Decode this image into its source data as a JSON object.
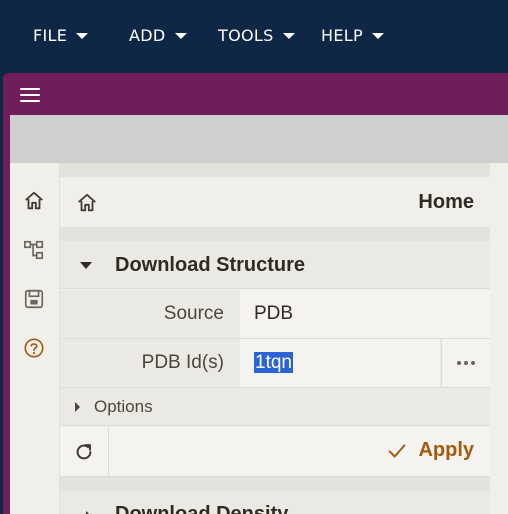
{
  "menu": [
    {
      "label": "FILE"
    },
    {
      "label": "ADD"
    },
    {
      "label": "TOOLS"
    },
    {
      "label": "HELP"
    }
  ],
  "colors": {
    "menubar": "#0f2746",
    "frame": "#701e5a",
    "selection": "#2b63d4",
    "apply": "#a65a10"
  },
  "rail": {
    "icons": [
      "home-icon",
      "tree-icon",
      "save-icon",
      "help-icon"
    ]
  },
  "home": {
    "title": "Home"
  },
  "download_structure": {
    "section_title": "Download Structure",
    "source_label": "Source",
    "source_value": "PDB",
    "pdb_label": "PDB Id(s)",
    "pdb_value": "1tqn",
    "options_label": "Options",
    "apply_label": "Apply"
  },
  "next_section": {
    "title": "Download Density"
  }
}
